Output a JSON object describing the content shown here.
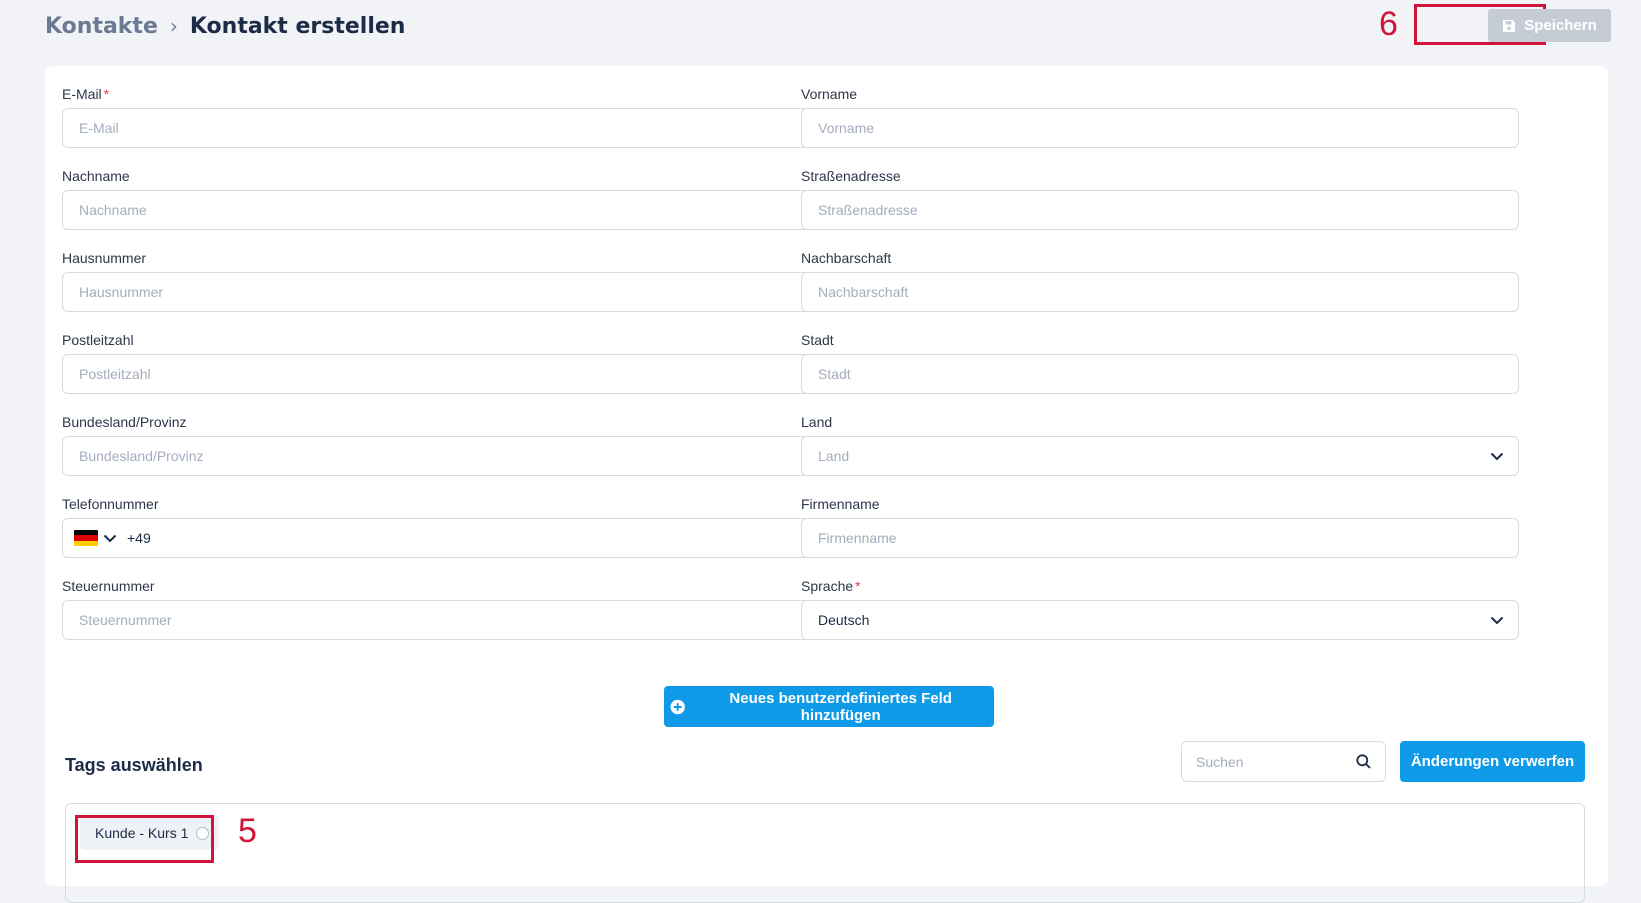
{
  "breadcrumb": {
    "root": "Kontakte",
    "separator": "›",
    "current": "Kontakt erstellen"
  },
  "header": {
    "save_label": "Speichern",
    "save_icon": "floppy-disk-icon"
  },
  "annotations": {
    "save": "6",
    "tag": "5"
  },
  "form": {
    "email": {
      "label": "E-Mail",
      "required": "*",
      "placeholder": "E-Mail"
    },
    "first_name": {
      "label": "Vorname",
      "placeholder": "Vorname"
    },
    "last_name": {
      "label": "Nachname",
      "placeholder": "Nachname"
    },
    "street": {
      "label": "Straßenadresse",
      "placeholder": "Straßenadresse"
    },
    "house_number": {
      "label": "Hausnummer",
      "placeholder": "Hausnummer"
    },
    "neighborhood": {
      "label": "Nachbarschaft",
      "placeholder": "Nachbarschaft"
    },
    "postal_code": {
      "label": "Postleitzahl",
      "placeholder": "Postleitzahl"
    },
    "city": {
      "label": "Stadt",
      "placeholder": "Stadt"
    },
    "state": {
      "label": "Bundesland/Provinz",
      "placeholder": "Bundesland/Provinz"
    },
    "country": {
      "label": "Land",
      "placeholder": "Land"
    },
    "phone": {
      "label": "Telefonnummer",
      "country_code": "+49",
      "flag": "germany-flag-icon"
    },
    "company": {
      "label": "Firmenname",
      "placeholder": "Firmenname"
    },
    "tax_number": {
      "label": "Steuernummer",
      "placeholder": "Steuernummer"
    },
    "language": {
      "label": "Sprache",
      "required": "*",
      "value": "Deutsch"
    }
  },
  "add_custom_field_label": "Neues benutzerdefiniertes Feld hinzufügen",
  "tags": {
    "title": "Tags auswählen",
    "search_placeholder": "Suchen",
    "discard_label": "Änderungen verwerfen",
    "items": [
      {
        "label": "Kunde - Kurs 1"
      }
    ]
  },
  "colors": {
    "accent": "#0f9ae8",
    "annotation": "#d0143c",
    "disabled": "#c6ccd5",
    "background": "#f1f3f7"
  }
}
